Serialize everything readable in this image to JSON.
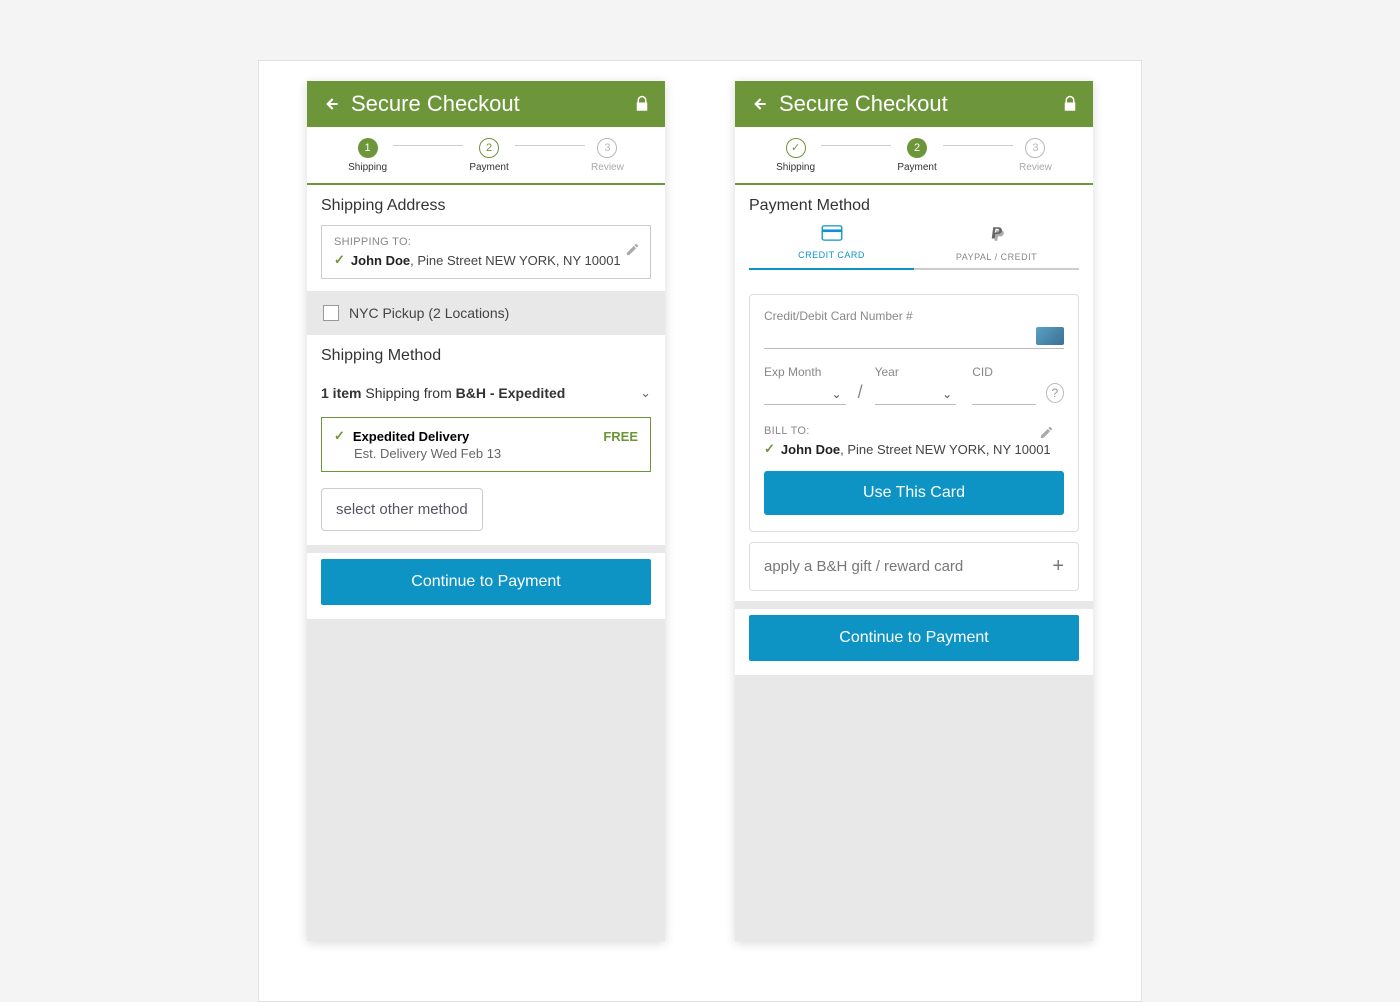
{
  "header": {
    "title": "Secure Checkout"
  },
  "steps": [
    "Shipping",
    "Payment",
    "Review"
  ],
  "screenA": {
    "shipping_addr_title": "Shipping Address",
    "shipping_to_label": "SHIPPING TO:",
    "name": "John Doe",
    "address": ", Pine Street NEW YORK, NY 10001",
    "pickup_label": "NYC Pickup (2 Locations)",
    "shipping_method_title": "Shipping Method",
    "item_count": "1 item",
    "shipping_from": " Shipping from ",
    "carrier": "B&H - Expedited",
    "opt_title": "Expedited Delivery",
    "opt_est": "Est. Delivery Wed Feb 13",
    "opt_price": "FREE",
    "other_method": "select other method",
    "continue": "Continue to Payment"
  },
  "screenB": {
    "payment_method_title": "Payment Method",
    "tab_card": "CREDIT CARD",
    "tab_paypal": "PAYPAL / CREDIT",
    "card_num_label": "Credit/Debit Card Number #",
    "exp_month_label": "Exp Month",
    "year_label": "Year",
    "cid_label": "CID",
    "bill_to_label": "BILL TO:",
    "bill_name": "John Doe",
    "bill_address": ", Pine Street NEW YORK, NY 10001",
    "use_card": "Use This Card",
    "gift_label": "apply a B&H gift / reward card",
    "continue": "Continue to Payment"
  }
}
